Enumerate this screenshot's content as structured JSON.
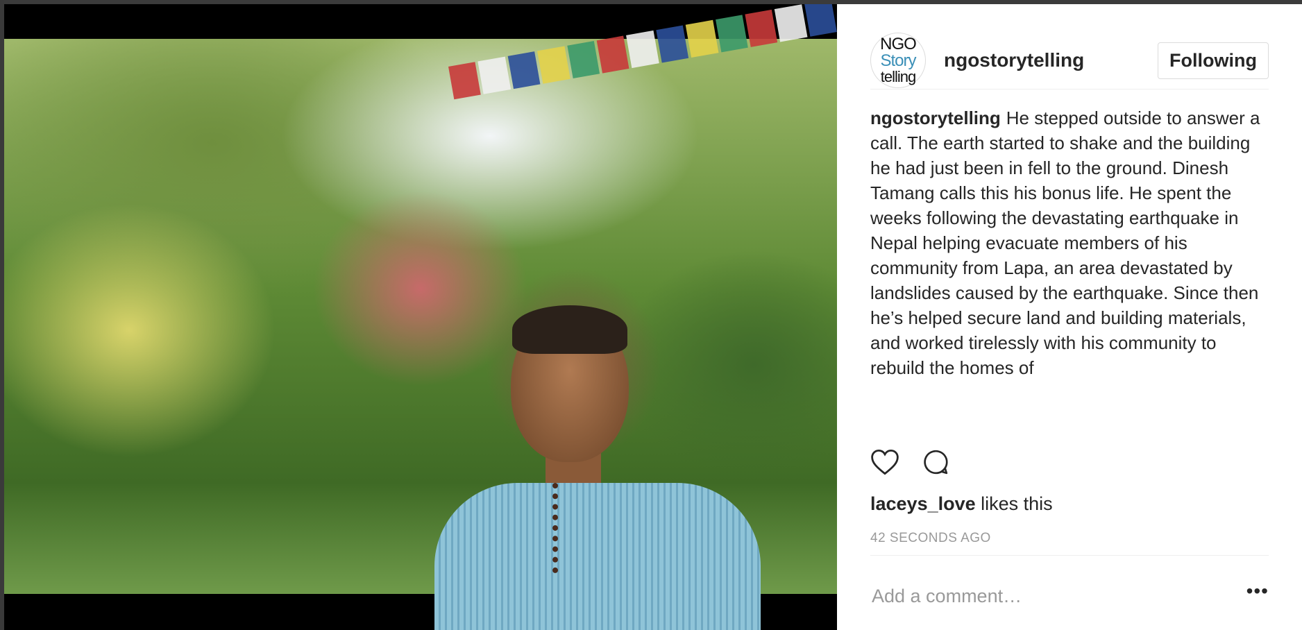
{
  "post": {
    "username": "ngostorytelling",
    "avatar_text": [
      "NGO",
      "Story",
      "telling"
    ],
    "follow_label": "Following",
    "caption_user": "ngostorytelling",
    "caption_text": "He stepped outside to answer a call. The earth started to shake and the building he had just been in fell to the ground. Dinesh Tamang calls this his bonus life. He spent the weeks following the devastating earthquake in Nepal helping evacuate members of his community from Lapa, an area devastated by landslides caused by the earthquake. Since then he’s helped secure land and building materials, and worked tirelessly with his community to rebuild the homes of",
    "likes": {
      "user": "laceys_love",
      "suffix": "likes this"
    },
    "timestamp": "42 SECONDS AGO",
    "comment_placeholder": "Add a comment…",
    "more_label": "•••"
  },
  "icons": {
    "like": "heart-icon",
    "comment": "speech-bubble-icon",
    "more": "more-options-icon"
  },
  "colors": {
    "text": "#262626",
    "muted": "#999999",
    "border": "#dbdbdb",
    "logo_accent": "#3a8fb7",
    "flags": [
      "#c83a3a",
      "#f0f0f0",
      "#2b4f9a",
      "#e3d24a",
      "#3c9a6a",
      "#c83a3a",
      "#f0f0f0",
      "#2b4f9a",
      "#e3d24a",
      "#3c9a6a",
      "#c83a3a",
      "#f0f0f0",
      "#2b4f9a"
    ]
  }
}
